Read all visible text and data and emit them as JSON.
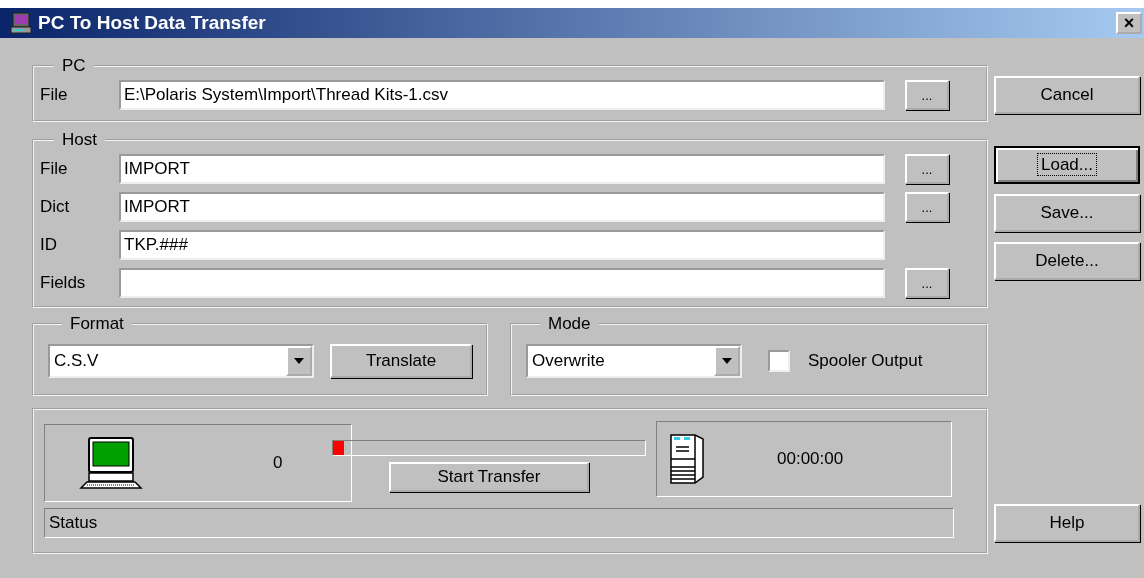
{
  "window": {
    "title": "PC To Host Data Transfer",
    "close": "×"
  },
  "pc": {
    "legend": "PC",
    "label": "File",
    "value": "E:\\Polaris System\\Import\\Thread Kits-1.csv",
    "browse": "..."
  },
  "host": {
    "legend": "Host",
    "fields": [
      {
        "label": "File",
        "value": "IMPORT",
        "browse": "..."
      },
      {
        "label": "Dict",
        "value": "IMPORT",
        "browse": "..."
      },
      {
        "label": "ID",
        "value": "TKP.###"
      },
      {
        "label": "Fields",
        "browse": "..."
      }
    ]
  },
  "format": {
    "legend": "Format",
    "value": "C.S.V",
    "button": "Translate"
  },
  "mode": {
    "legend": "Mode",
    "value": "Overwrite",
    "checkbox": {
      "label": "Spooler Output",
      "checked": false
    }
  },
  "transfer": {
    "count": "0",
    "level": 0.035,
    "button": "Start Transfer",
    "time": "00:00:00",
    "status": "Status"
  },
  "buttons": [
    {
      "label": "Cancel",
      "focused": false
    },
    {
      "label": "Load...",
      "focused": true
    },
    {
      "label": "Save...",
      "focused": false
    },
    {
      "label": "Delete...",
      "focused": false
    }
  ],
  "help": {
    "label": "Help",
    "focused": false
  }
}
